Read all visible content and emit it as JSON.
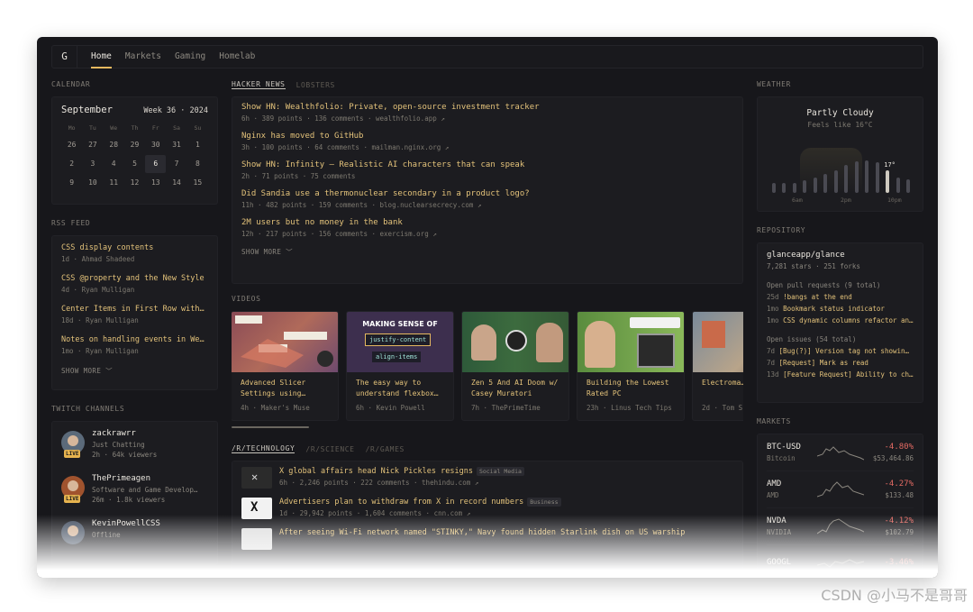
{
  "nav": {
    "logo": "G",
    "tabs": [
      {
        "label": "Home",
        "active": true
      },
      {
        "label": "Markets",
        "active": false
      },
      {
        "label": "Gaming",
        "active": false
      },
      {
        "label": "Homelab",
        "active": false
      }
    ]
  },
  "calendar": {
    "title": "CALENDAR",
    "month": "September",
    "week_label": "Week 36 · 2024",
    "day_headers": [
      "Mo",
      "Tu",
      "We",
      "Th",
      "Fr",
      "Sa",
      "Su"
    ],
    "days": [
      "26",
      "27",
      "28",
      "29",
      "30",
      "31",
      "1",
      "2",
      "3",
      "4",
      "5",
      "6",
      "7",
      "8",
      "9",
      "10",
      "11",
      "12",
      "13",
      "14",
      "15"
    ],
    "today": "6"
  },
  "rss": {
    "title": "RSS FEED",
    "items": [
      {
        "title": "CSS display contents",
        "meta": "1d · Ahmad Shadeed"
      },
      {
        "title": "CSS @property and the New Style",
        "meta": "4d · Ryan Mulligan"
      },
      {
        "title": "Center Items in First Row with…",
        "meta": "18d · Ryan Mulligan"
      },
      {
        "title": "Notes on handling events in We…",
        "meta": "1mo · Ryan Mulligan"
      }
    ],
    "show_more": "SHOW MORE"
  },
  "twitch": {
    "title": "TWITCH CHANNELS",
    "channels": [
      {
        "name": "zackrawrr",
        "activity": "Just Chatting",
        "stats": "2h · 64k viewers",
        "live": "LIVE"
      },
      {
        "name": "ThePrimeagen",
        "activity": "Software and Game Develop…",
        "stats": "26m · 1.8k viewers",
        "live": "LIVE"
      },
      {
        "name": "KevinPowellCSS",
        "activity": "Offline",
        "stats": "",
        "live": ""
      }
    ]
  },
  "news": {
    "tabs": [
      "HACKER NEWS",
      "LOBSTERS"
    ],
    "items": [
      {
        "title": "Show HN: Wealthfolio: Private, open-source investment tracker",
        "meta": "6h · 389 points · 136 comments · wealthfolio.app ↗"
      },
      {
        "title": "Nginx has moved to GitHub",
        "meta": "3h · 100 points · 64 comments · mailman.nginx.org ↗"
      },
      {
        "title": "Show HN: Infinity – Realistic AI characters that can speak",
        "meta": "2h · 71 points · 75 comments"
      },
      {
        "title": "Did Sandia use a thermonuclear secondary in a product logo?",
        "meta": "11h · 482 points · 159 comments · blog.nuclearsecrecy.com ↗"
      },
      {
        "title": "2M users but no money in the bank",
        "meta": "12h · 217 points · 156 comments · exercism.org ↗"
      }
    ],
    "show_more": "SHOW MORE"
  },
  "videos": {
    "title": "VIDEOS",
    "items": [
      {
        "title": "Advanced Slicer Settings using…",
        "meta": "4h · Maker's Muse",
        "thumb_color": "#7d4a4a",
        "thumb_text": "10% cubic  100% concentric  60% cubic"
      },
      {
        "title": "The easy way to understand flexbox…",
        "meta": "6h · Kevin Powell",
        "thumb_color": "#3a2f4a",
        "thumb_text": "MAKING SENSE OF"
      },
      {
        "title": "Zen 5 And AI Doom w/ Casey Muratori",
        "meta": "7h · ThePrimeTime",
        "thumb_color": "#2f5a3c",
        "thumb_text": ""
      },
      {
        "title": "Building the Lowest Rated PC",
        "meta": "23h · Linus Tech Tips",
        "thumb_color": "#4a7a3c",
        "thumb_text": ""
      },
      {
        "title": "Electroma… Aircraft",
        "meta": "2d · Tom S",
        "thumb_color": "#6a6258",
        "thumb_text": ""
      }
    ],
    "thumb_tags": [
      "justify-content",
      "align-items"
    ]
  },
  "reddit": {
    "tabs": [
      "/R/TECHNOLOGY",
      "/R/SCIENCE",
      "/R/GAMES"
    ],
    "items": [
      {
        "title": "X global affairs head Nick Pickles resigns",
        "flair": "Social Media",
        "meta": "6h · 2,246 points · 222 comments · thehindu.com ↗"
      },
      {
        "title": "Advertisers plan to withdraw from X in record numbers",
        "flair": "Business",
        "meta": "1d · 29,942 points · 1,604 comments · cnn.com ↗"
      },
      {
        "title": "After seeing Wi-Fi network named \"STINKY,\" Navy found hidden Starlink dish on US warship",
        "flair": "",
        "meta": ""
      }
    ]
  },
  "weather": {
    "title": "WEATHER",
    "condition": "Partly Cloudy",
    "feels_like": "Feels like 16°C",
    "current_temp": "17°",
    "labels": [
      "6am",
      "2pm",
      "10pm"
    ],
    "bar_levels": [
      0.22,
      0.22,
      0.22,
      0.28,
      0.35,
      0.42,
      0.5,
      0.62,
      0.7,
      0.72,
      0.68,
      0.5,
      0.35,
      0.3
    ],
    "current_index": 11,
    "daylight_range": [
      3,
      8
    ]
  },
  "repository": {
    "title": "REPOSITORY",
    "name": "glanceapp/glance",
    "stats": "7,281 stars · 251 forks",
    "prs_title": "Open pull requests (9 total)",
    "prs": [
      {
        "age": "25d",
        "title": "!bangs at the end"
      },
      {
        "age": "1mo",
        "title": "Bookmark status indicator"
      },
      {
        "age": "1mo",
        "title": "CSS dynamic columns refactor an…"
      }
    ],
    "issues_title": "Open issues (54 total)",
    "issues": [
      {
        "age": "7d",
        "title": "[Bug(?)] Version tag not showin…"
      },
      {
        "age": "7d",
        "title": "[Request] Mark as read"
      },
      {
        "age": "13d",
        "title": "[Feature Request] Ability to ch…"
      }
    ]
  },
  "markets": {
    "title": "MARKETS",
    "items": [
      {
        "symbol": "BTC-USD",
        "name": "Bitcoin",
        "change": "-4.80%",
        "price": "$53,464.86"
      },
      {
        "symbol": "AMD",
        "name": "AMD",
        "change": "-4.27%",
        "price": "$133.48"
      },
      {
        "symbol": "NVDA",
        "name": "NVIDIA",
        "change": "-4.12%",
        "price": "$102.79"
      },
      {
        "symbol": "GOOGL",
        "name": "",
        "change": "-3.46%",
        "price": ""
      }
    ]
  },
  "watermark": "CSDN @小马不是哥哥",
  "colors": {
    "accent": "#e3c27a",
    "negative": "#e36a63",
    "background": "#17171b"
  }
}
